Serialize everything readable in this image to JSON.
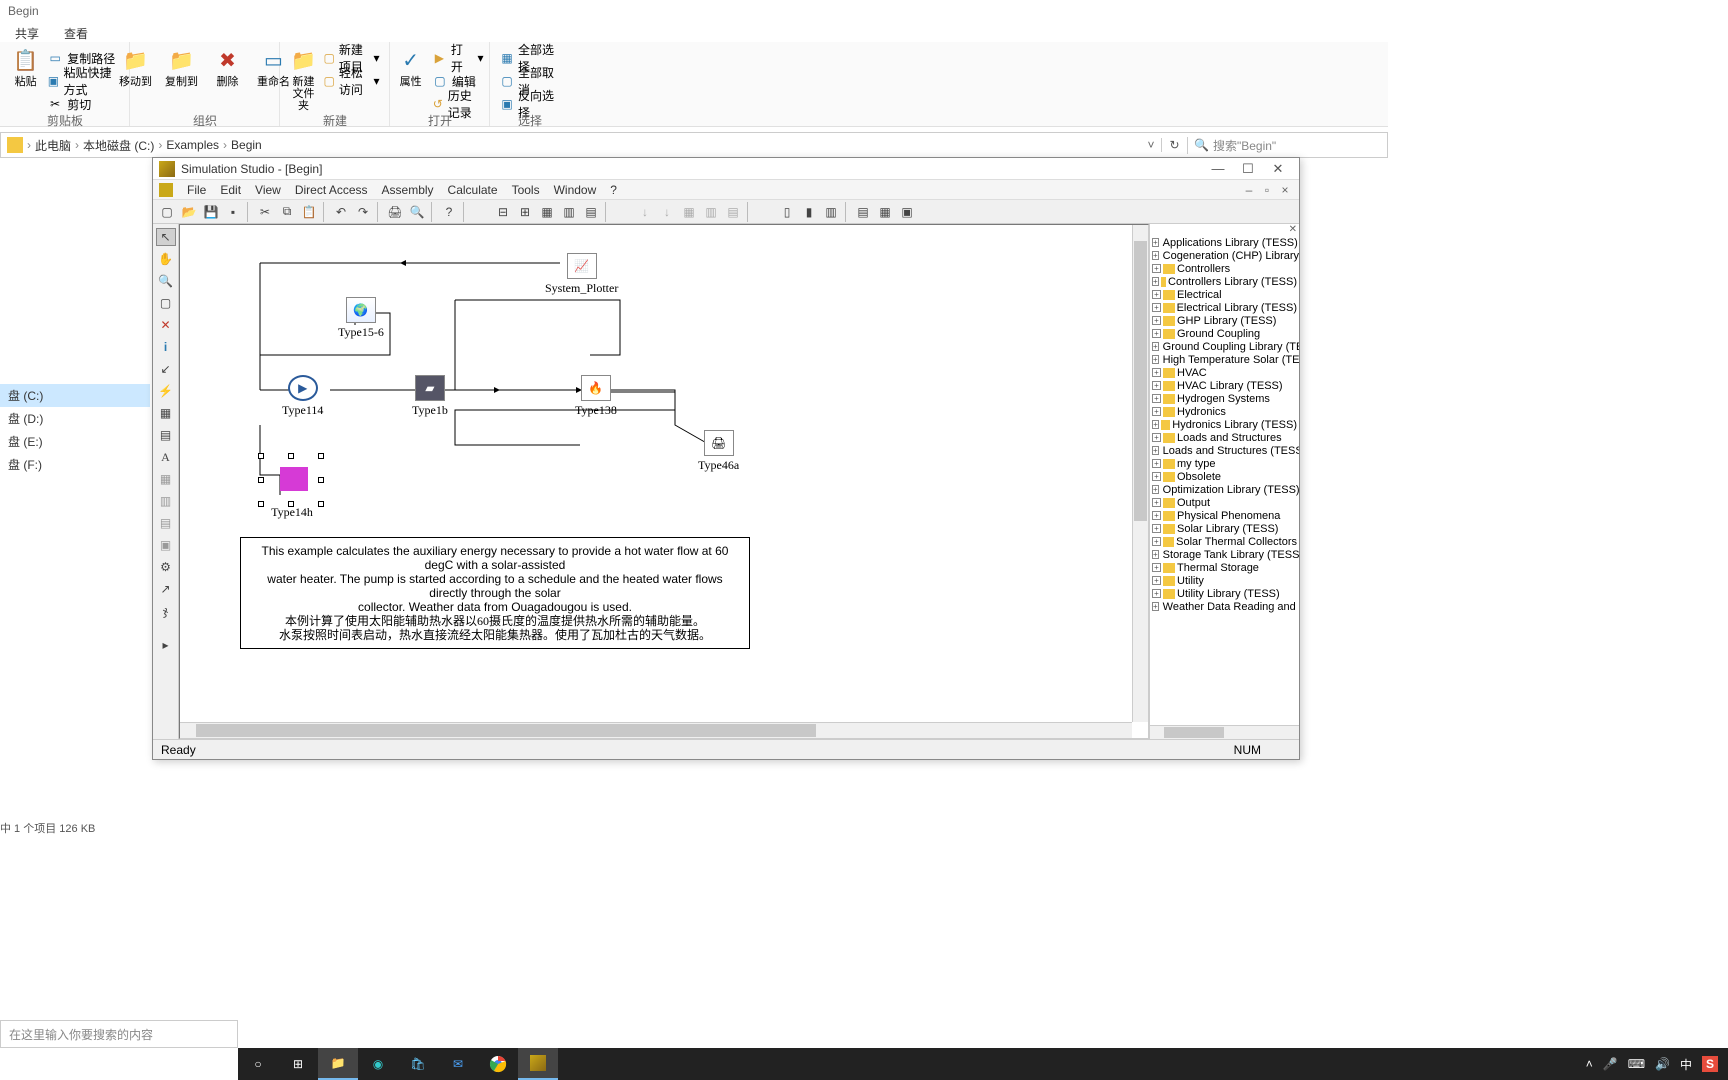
{
  "explorer": {
    "title": "Begin",
    "tabs": {
      "share": "共享",
      "view": "查看"
    },
    "ribbon": {
      "paste": "粘贴",
      "copy_path": "复制路径",
      "paste_shortcut": "粘贴快捷方式",
      "cut": "剪切",
      "move_to": "移动到",
      "copy_to": "复制到",
      "delete": "删除",
      "rename": "重命名",
      "new_folder": "新建\n文件夹",
      "new_item": "新建项目",
      "easy_access": "轻松访问",
      "properties": "属性",
      "open": "打开",
      "edit": "编辑",
      "history": "历史记录",
      "select_all": "全部选择",
      "select_none": "全部取消",
      "invert": "反向选择",
      "grp_clipboard": "剪贴板",
      "grp_organize": "组织",
      "grp_new": "新建",
      "grp_open": "打开",
      "grp_select": "选择"
    },
    "breadcrumb": {
      "pc": "此电脑",
      "drive": "本地磁盘 (C:)",
      "examples": "Examples",
      "begin": "Begin",
      "sep": "›"
    },
    "search_placeholder": "搜索\"Begin\"",
    "drives": {
      "c": "盘 (C:)",
      "d": "盘 (D:)",
      "e": "盘 (E:)",
      "f": "盘 (F:)"
    },
    "status": "中 1 个项目   126 KB"
  },
  "sim": {
    "title": "Simulation Studio - [Begin]",
    "menu": {
      "file": "File",
      "edit": "Edit",
      "view": "View",
      "direct": "Direct Access",
      "assembly": "Assembly",
      "calculate": "Calculate",
      "tools": "Tools",
      "window": "Window",
      "help": "?"
    },
    "canvas": {
      "plotter": "System_Plotter",
      "t15": "Type15-6",
      "t114": "Type114",
      "t1b": "Type1b",
      "t138": "Type138",
      "t46a": "Type46a",
      "t14h": "Type14h",
      "desc_en1": "This example calculates the auxiliary energy necessary to provide a hot water flow at 60 degC with a solar-assisted",
      "desc_en2": "water heater.  The pump is started according to a schedule and the heated water flows directly through the solar",
      "desc_en3": "collector.  Weather data from Ouagadougou is used.",
      "desc_cn1": "本例计算了使用太阳能辅助热水器以60摄氏度的温度提供热水所需的辅助能量。",
      "desc_cn2": "水泵按照时间表启动，热水直接流经太阳能集热器。使用了瓦加杜古的天气数据。"
    },
    "tree": [
      "Applications Library (TESS)",
      "Cogeneration (CHP) Library (T",
      "Controllers",
      "Controllers Library (TESS)",
      "Electrical",
      "Electrical Library (TESS)",
      "GHP Library (TESS)",
      "Ground Coupling",
      "Ground Coupling Library (TES",
      "High Temperature Solar (TES",
      "HVAC",
      "HVAC Library (TESS)",
      "Hydrogen Systems",
      "Hydronics",
      "Hydronics Library (TESS)",
      "Loads and Structures",
      "Loads and Structures (TESS)",
      "my type",
      "Obsolete",
      "Optimization Library (TESS)",
      "Output",
      "Physical Phenomena",
      "Solar Library (TESS)",
      "Solar Thermal Collectors",
      "Storage Tank Library (TESS)",
      "Thermal Storage",
      "Utility",
      "Utility Library (TESS)",
      "Weather Data Reading and P"
    ],
    "status": {
      "ready": "Ready",
      "num": "NUM"
    }
  },
  "taskbar": {
    "search": "在这里输入你要搜索的内容",
    "ime": "中"
  }
}
